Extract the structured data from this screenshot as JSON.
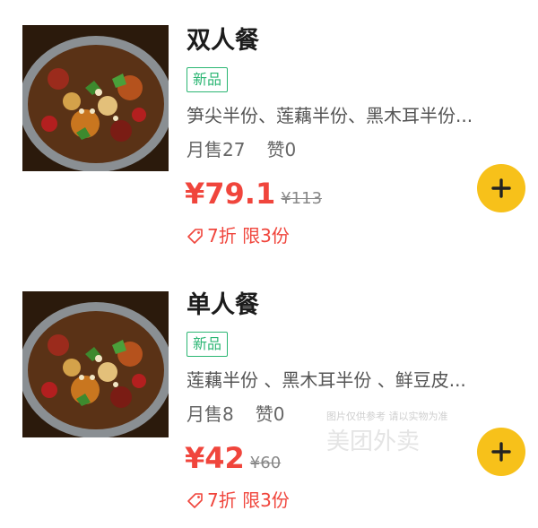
{
  "items": [
    {
      "name": "双人餐",
      "tag": "新品",
      "description": "笋尖半份、莲藕半份、黑木耳半份...",
      "monthly_sales": "月售27",
      "likes": "赞0",
      "price": "¥79.1",
      "original_price": "¥113",
      "promo": "7折 限3份",
      "image_icon": "dry-pot-dish-photo",
      "add_icon": "plus-icon"
    },
    {
      "name": "单人餐",
      "tag": "新品",
      "description": "莲藕半份 、黑木耳半份 、鲜豆皮...",
      "monthly_sales": "月售8",
      "likes": "赞0",
      "price": "¥42",
      "original_price": "¥60",
      "promo": "7折 限3份",
      "image_icon": "dry-pot-dish-photo",
      "add_icon": "plus-icon"
    }
  ],
  "watermark": {
    "notice": "图片仅供参考 请以实物为准",
    "brand": "美团外卖"
  },
  "colors": {
    "price": "#f0453c",
    "tag_green": "#2bb673",
    "add_button": "#f7c11a"
  }
}
